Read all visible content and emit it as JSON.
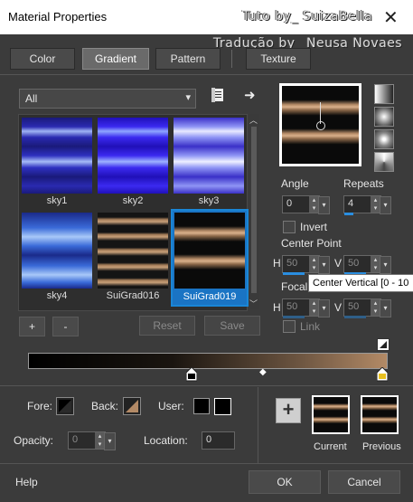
{
  "window": {
    "title": "Material Properties",
    "close_glyph": "✕"
  },
  "watermark": {
    "line1": "Tuto by_ SuizaBella",
    "line2": "Tradução by_ Neusa Novaes"
  },
  "tabs": [
    {
      "label": "Color"
    },
    {
      "label": "Gradient",
      "active": true
    },
    {
      "label": "Pattern"
    },
    {
      "label": "Texture"
    }
  ],
  "filter": {
    "selected": "All",
    "arrow": "▾",
    "browse_icon": "open-file-icon",
    "apply_icon": "arrow-right-icon",
    "apply_glyph": "➜"
  },
  "gradients": [
    {
      "name": "sky1"
    },
    {
      "name": "sky2"
    },
    {
      "name": "sky3"
    },
    {
      "name": "sky4"
    },
    {
      "name": "SuiGrad016"
    },
    {
      "name": "SuiGrad019",
      "selected": true
    }
  ],
  "list_buttons": {
    "add": "+",
    "remove": "-",
    "reset": "Reset",
    "save": "Save"
  },
  "angle": {
    "label": "Angle",
    "value": "0"
  },
  "repeats": {
    "label": "Repeats",
    "value": "4"
  },
  "invert": {
    "label": "Invert",
    "checked": false
  },
  "center_point": {
    "label": "Center Point",
    "h_label": "H",
    "h_value": "50",
    "v_label": "V",
    "v_value": "50"
  },
  "focal_point": {
    "label": "Focal",
    "h_label": "H",
    "h_value": "50",
    "v_label": "V",
    "v_value": "50"
  },
  "link": {
    "label": "Link",
    "checked": false
  },
  "tooltip": {
    "text": "Center Vertical [0 - 10"
  },
  "gradient_bar": {
    "stop_colors": [
      "#000000",
      "#b38a66"
    ],
    "midpoint_glyph": "◆"
  },
  "bottom": {
    "fore_label": "Fore:",
    "back_label": "Back:",
    "user_label": "User:",
    "opacity_label": "Opacity:",
    "opacity_value": "0",
    "location_label": "Location:",
    "location_value": "0",
    "plus_glyph": "+",
    "current_label": "Current",
    "previous_label": "Previous"
  },
  "footer": {
    "help": "Help",
    "ok": "OK",
    "cancel": "Cancel"
  },
  "colors": {
    "accent": "#1a86d6",
    "background": "#3b3b3b",
    "stripe": "#b38a66"
  }
}
